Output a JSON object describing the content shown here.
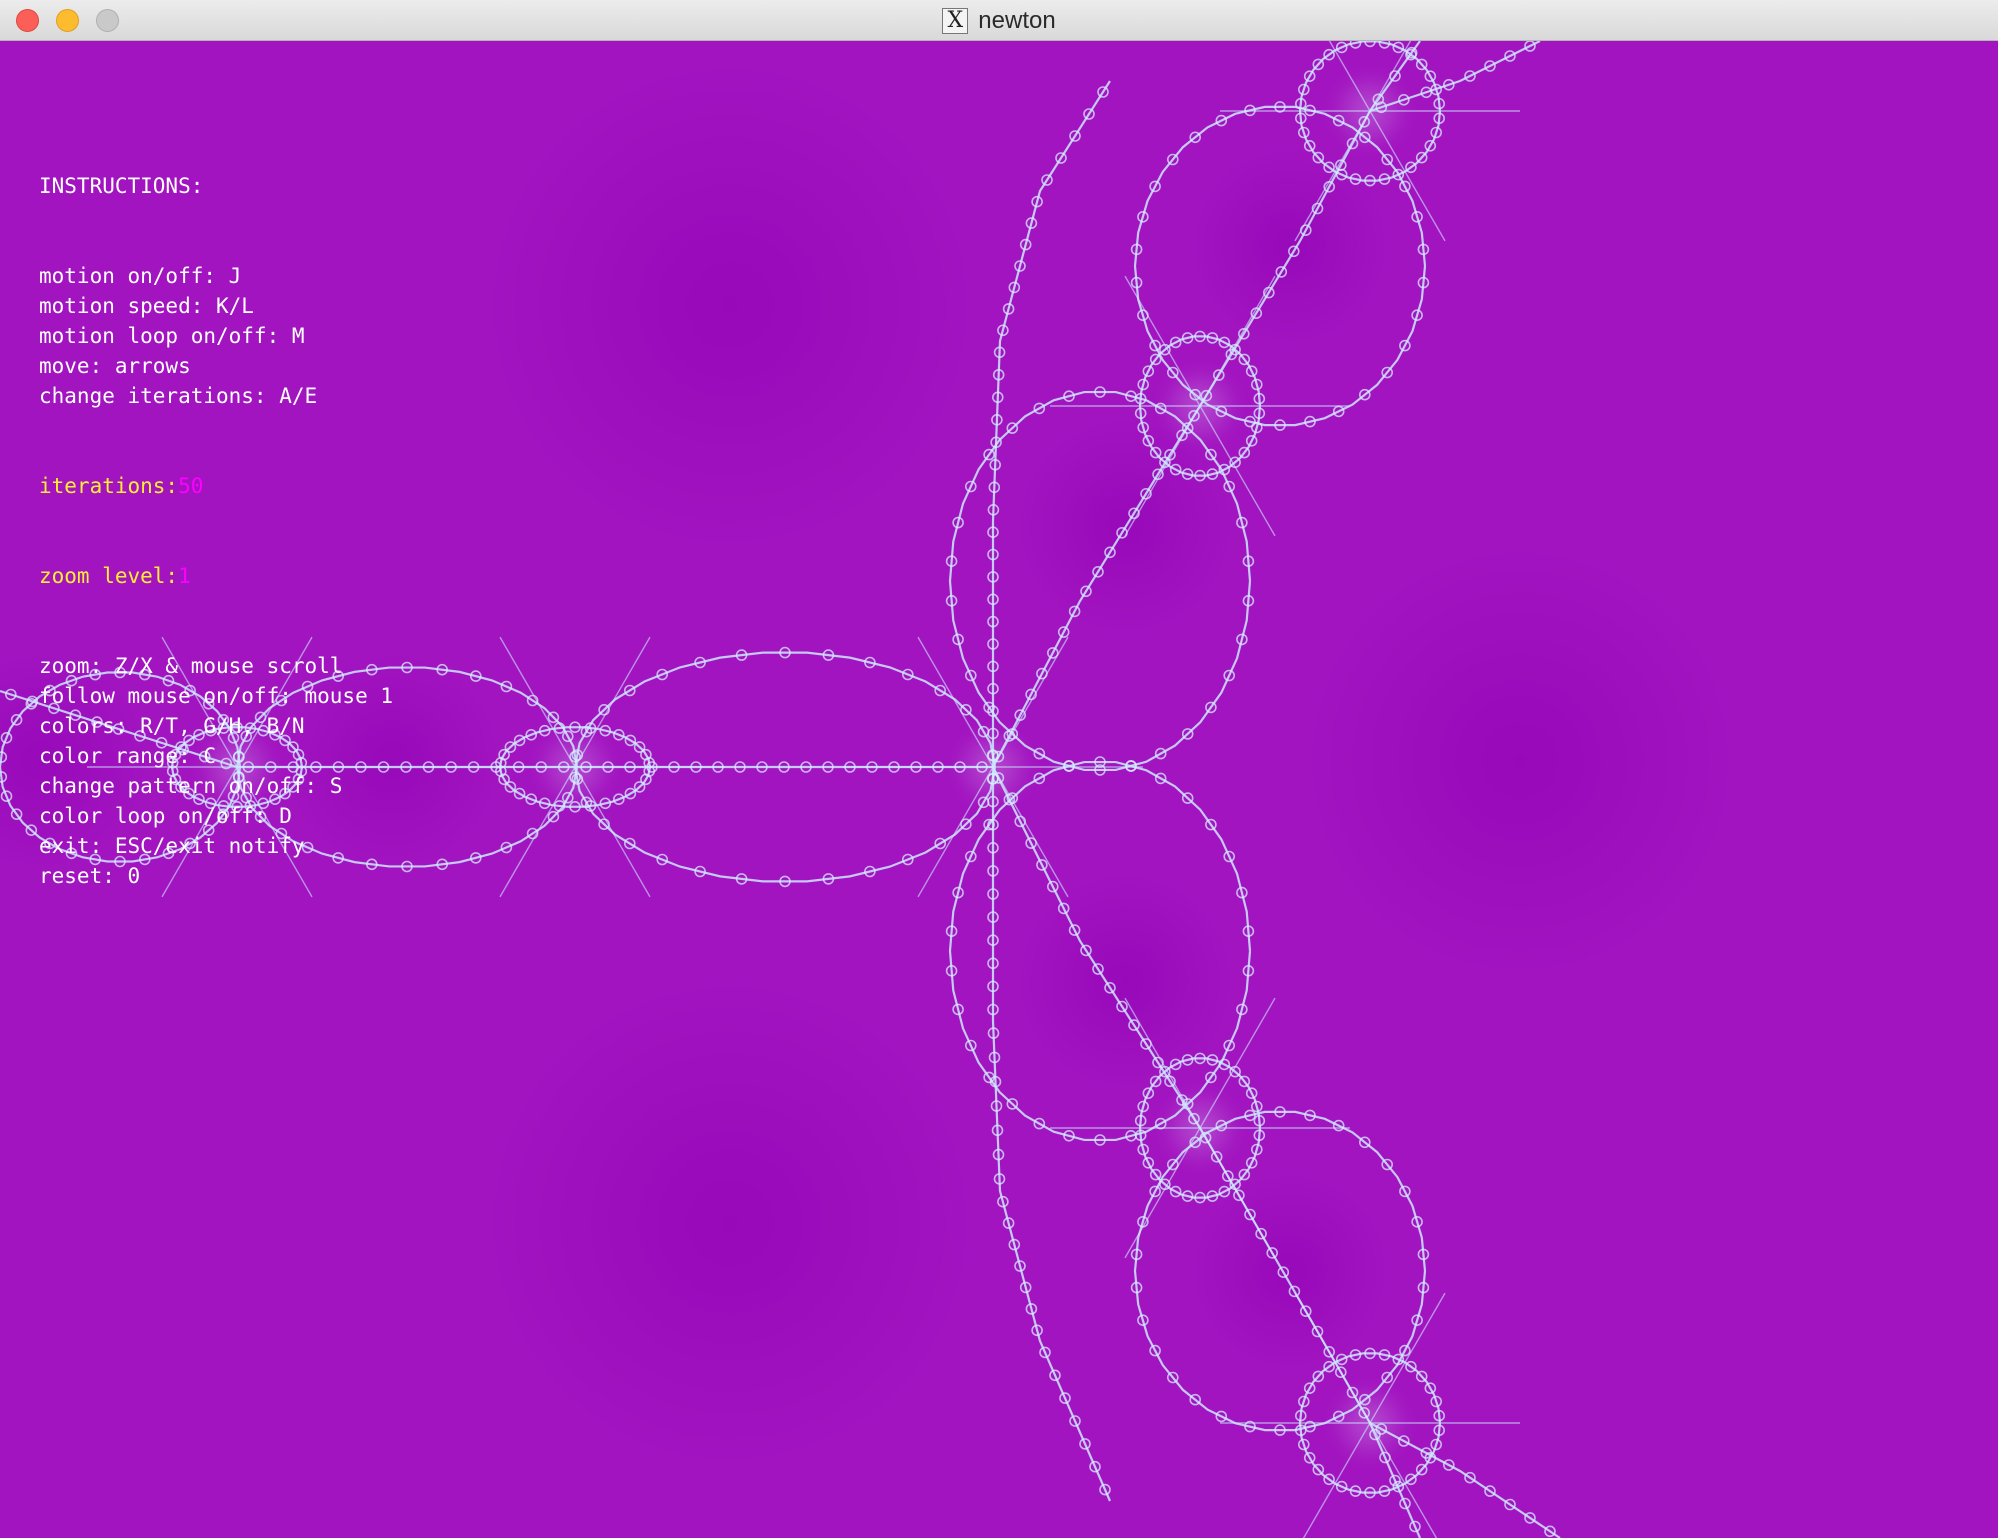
{
  "window": {
    "title": "newton",
    "app_icon": "x11-icon",
    "app_icon_glyph": "X"
  },
  "canvas": {
    "background_color": "#a214c0",
    "filament_color": "#cde8ff",
    "basin_center_color": "#8f00b4"
  },
  "instructions": {
    "heading": "INSTRUCTIONS:",
    "lines_before": [
      "motion on/off: J",
      "motion speed: K/L",
      "motion loop on/off: M",
      "move: arrows",
      "change iterations: A/E"
    ],
    "iterations_label": "iterations:",
    "iterations_value": "50",
    "zoom_level_label": "zoom level:",
    "zoom_level_value": "1",
    "lines_after": [
      "zoom: Z/X & mouse scroll",
      "follow mouse on/off: mouse 1",
      "colors: R/T, G/H, B/N",
      "color range: C",
      "change pattern on/off: S",
      "color loop on/off: D",
      "exit: ESC/exit notify",
      "reset: 0"
    ],
    "label_color": "#ffee33",
    "value_color": "#ff00ff",
    "text_color": "#ffffff"
  }
}
